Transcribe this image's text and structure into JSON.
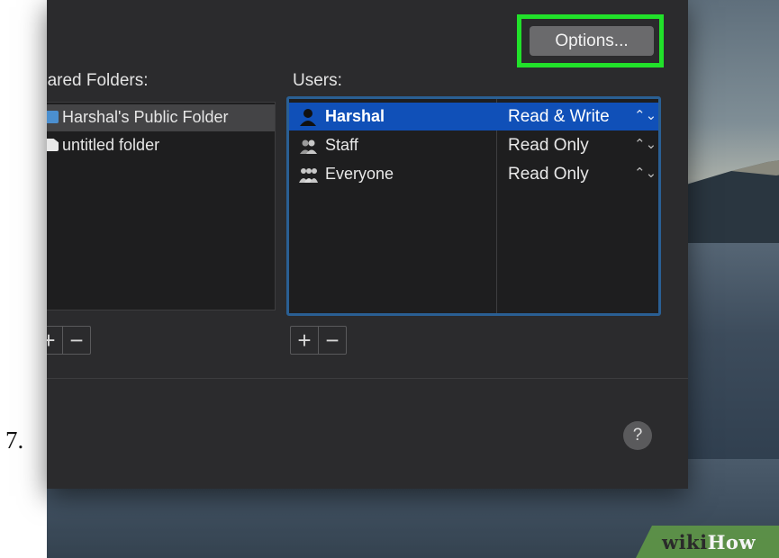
{
  "step": {
    "number": "7."
  },
  "sharing": {
    "folders_label": "hared Folders:",
    "users_label": "Users:",
    "options_label": "Options...",
    "help_label": "?",
    "add_label": "+",
    "remove_label": "−"
  },
  "folders": [
    {
      "name": "Harshal's Public Folder",
      "icon": "folder-icon",
      "selected": true
    },
    {
      "name": "untitled folder",
      "icon": "file-icon",
      "selected": false
    }
  ],
  "users": [
    {
      "name": "Harshal",
      "permission": "Read & Write",
      "icon": "user-icon",
      "selected": true
    },
    {
      "name": "Staff",
      "permission": "Read Only",
      "icon": "group-icon",
      "selected": false
    },
    {
      "name": "Everyone",
      "permission": "Read Only",
      "icon": "everyone-icon",
      "selected": false
    }
  ],
  "stepper_glyph": "⌃⌄",
  "watermark": {
    "wiki": "wiki",
    "how": "How"
  },
  "colors": {
    "highlight": "#21e12a",
    "selection": "#1050b8",
    "focus_ring": "#2a5f93",
    "window_bg": "#2b2b2d"
  }
}
